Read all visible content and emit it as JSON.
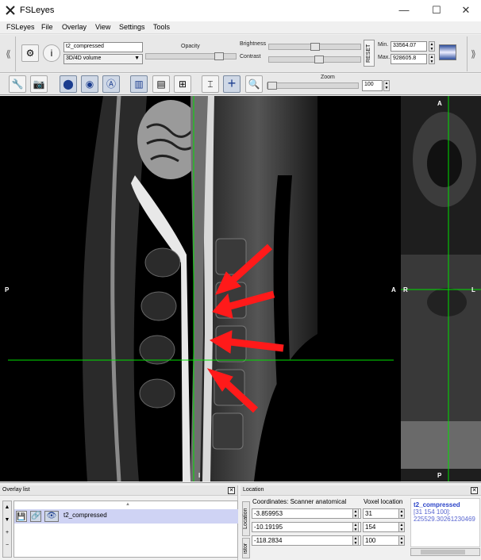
{
  "window": {
    "title": "FSLeyes",
    "minimize": "—",
    "maximize": "☐",
    "close": "✕"
  },
  "menu": [
    "FSLeyes",
    "File",
    "Overlay",
    "View",
    "Settings",
    "Tools"
  ],
  "toolbar1": {
    "overlay_name": "t2_compressed",
    "overlay_type": "3D/4D volume",
    "opacity_label": "Opacity",
    "brightness_label": "Brightness",
    "contrast_label": "Contrast",
    "reset_label": "RESET",
    "min_label": "Min.",
    "max_label": "Max.",
    "min_value": "33564.07",
    "max_value": "928605.8",
    "opacity_level": 0.85,
    "brightness_level": 0.5,
    "contrast_level": 0.55
  },
  "toolbar2": {
    "zoom_label": "Zoom",
    "zoom_value": "100",
    "zoom_level": 0.0
  },
  "orientation": {
    "sagittal": {
      "top": "",
      "left": "P",
      "right": "A",
      "bottom": "I"
    },
    "axial": {
      "top": "A",
      "left": "R",
      "right": "L",
      "bottom": "P"
    }
  },
  "colors": {
    "cursor": "#00e000",
    "arrow": "#ff1a1a",
    "accent": "#1b3d8f"
  },
  "overlay_list": {
    "title": "Overlay list",
    "items": [
      {
        "name": "t2_compressed"
      }
    ]
  },
  "location": {
    "title": "Location",
    "coord_header": "Coordinates: Scanner anatomical",
    "voxel_header": "Voxel location",
    "coords": [
      "-3.859953",
      "-10.19195",
      "-118.2834"
    ],
    "voxels": [
      "31",
      "154",
      "100"
    ],
    "side_label1": "Location",
    "side_label2": "istor",
    "info_name": "t2_compressed",
    "info_voxel": "[31 154 100]:",
    "info_value": "225529.30261230469"
  }
}
